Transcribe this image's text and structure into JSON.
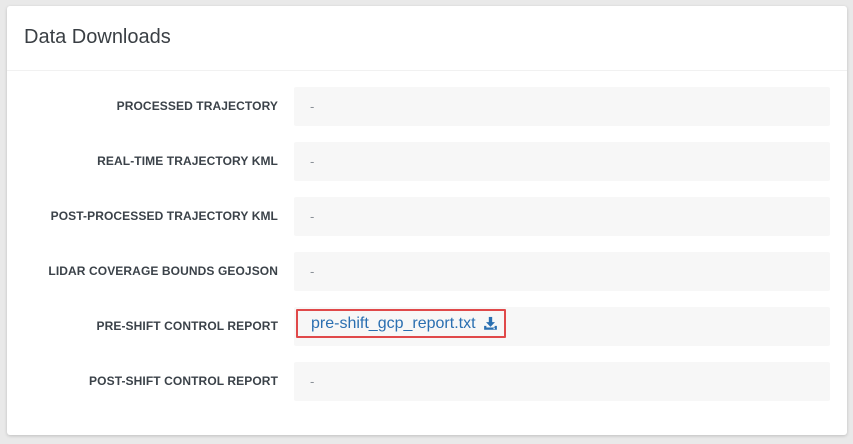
{
  "panel": {
    "title": "Data Downloads"
  },
  "downloads": [
    {
      "label": "PROCESSED TRAJECTORY",
      "value": "-"
    },
    {
      "label": "REAL-TIME TRAJECTORY KML",
      "value": "-"
    },
    {
      "label": "POST-PROCESSED TRAJECTORY KML",
      "value": "-"
    },
    {
      "label": "LIDAR COVERAGE BOUNDS GEOJSON",
      "value": "-"
    },
    {
      "label": "PRE-SHIFT CONTROL REPORT",
      "value": "pre-shift_gcp_report.txt",
      "icon": "download-icon"
    },
    {
      "label": "POST-SHIFT CONTROL REPORT",
      "value": "-"
    }
  ],
  "colors": {
    "link": "#2a6fb1",
    "highlight_border": "#e0494a"
  }
}
